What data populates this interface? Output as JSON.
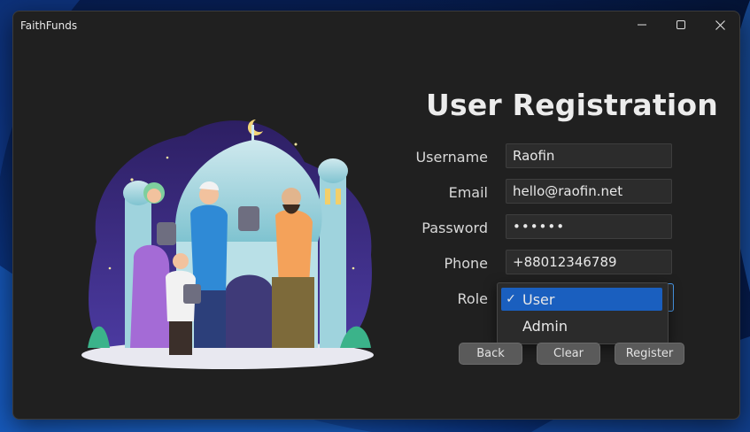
{
  "window": {
    "title": "FaithFunds",
    "controls": {
      "minimize_icon": "minimize-icon",
      "maximize_icon": "maximize-icon",
      "close_icon": "close-icon"
    }
  },
  "form": {
    "title": "User Registration",
    "fields": [
      {
        "label": "Username",
        "value": "Raofin"
      },
      {
        "label": "Email",
        "value": "hello@raofin.net"
      },
      {
        "label": "Password",
        "value": "••••••"
      },
      {
        "label": "Phone",
        "value": "+88012346789"
      }
    ],
    "role": {
      "label": "Role",
      "selected": "User",
      "options": [
        "User",
        "Admin"
      ],
      "check_mark": "✓"
    },
    "buttons": {
      "back": "Back",
      "clear": "Clear",
      "register": "Register"
    }
  },
  "colors": {
    "accent": "#1a5fbf",
    "focus_border": "#4a9df0",
    "window_bg": "#202020"
  }
}
